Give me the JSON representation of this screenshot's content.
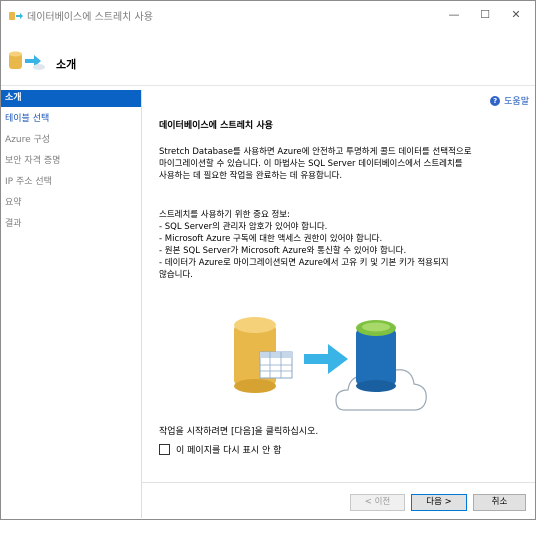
{
  "window": {
    "title": "데이터베이스에 스트레치 사용",
    "minimize_glyph": "—",
    "maximize_glyph": "☐",
    "close_glyph": "✕"
  },
  "header": {
    "title": "소개"
  },
  "sidebar": {
    "items": [
      {
        "label": "소개",
        "state": "active"
      },
      {
        "label": "테이블 선택",
        "state": "link"
      },
      {
        "label": "Azure 구성",
        "state": "disabled"
      },
      {
        "label": "보안 자격 증명",
        "state": "disabled"
      },
      {
        "label": "IP 주소 선택",
        "state": "disabled"
      },
      {
        "label": "요약",
        "state": "disabled"
      },
      {
        "label": "결과",
        "state": "disabled"
      }
    ]
  },
  "content": {
    "help_label": "도움말",
    "heading": "데이터베이스에 스트레치 사용",
    "intro_lines": [
      "Stretch Database를 사용하면 Azure에 안전하고 투명하게 콜드 데이터를 선택적으로",
      "마이그레이션할 수 있습니다. 이 마법사는 SQL Server 데이터베이스에서 스트레치를",
      "사용하는 데 필요한 작업을 완료하는 데 유용합니다."
    ],
    "info_title": "스트레치를 사용하기 위한 중요 정보:",
    "info_lines": [
      "- SQL Server의 관리자 암호가 있어야 합니다.",
      "- Microsoft Azure 구독에 대한 액세스 권한이 있어야 합니다.",
      "- 원본 SQL Server가 Microsoft Azure와 통신할 수 있어야 합니다.",
      "- 데이터가 Azure로 마이그레이션되면 Azure에서 고유 키 및 기본 키가 적용되지",
      "않습니다."
    ],
    "start_text": "작업을 시작하려면 [다음]을 클릭하십시오.",
    "checkbox_label": "이 페이지를 다시 표시 안 함"
  },
  "footer": {
    "prev_label": "< 이전",
    "next_label": "다음 >",
    "cancel_label": "취소"
  },
  "colors": {
    "accent": "#0a62c4",
    "link": "#1a55b7",
    "db_gold": "#e9b84a",
    "db_blue": "#1f6fb8",
    "db_green": "#7fc241",
    "arrow": "#3ab3e6"
  }
}
